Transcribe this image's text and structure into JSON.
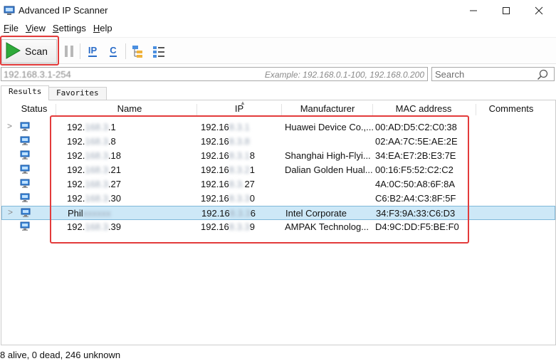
{
  "window": {
    "title": "Advanced IP Scanner"
  },
  "menu": [
    {
      "label_u": "F",
      "label_rest": "ile"
    },
    {
      "label_u": "V",
      "label_rest": "iew"
    },
    {
      "label_u": "S",
      "label_rest": "ettings"
    },
    {
      "label_u": "H",
      "label_rest": "elp"
    }
  ],
  "toolbar": {
    "scan_label": "Scan",
    "ip_label": "IP",
    "c_label": "C"
  },
  "range": {
    "value": "192.168.3.1-254",
    "example": "Example: 192.168.0.1-100, 192.168.0.200"
  },
  "search": {
    "placeholder": "Search"
  },
  "tabs": [
    "Results",
    "Favorites"
  ],
  "columns": {
    "status": "Status",
    "name": "Name",
    "ip": "IP",
    "manufacturer": "Manufacturer",
    "mac": "MAC address",
    "comments": "Comments"
  },
  "rows": [
    {
      "expand": ">",
      "name_a": "192.",
      "name_b": "168.3",
      "name_c": ".1",
      "ip_a": "192.16",
      "ip_b": "8.3.1",
      "ip_c": "",
      "manufacturer": "Huawei Device Co.,...",
      "mac": "00:AD:D5:C2:C0:38",
      "selected": false
    },
    {
      "expand": "",
      "name_a": "192.",
      "name_b": "168.3",
      "name_c": ".8",
      "ip_a": "192.16",
      "ip_b": "8.3.8",
      "ip_c": "",
      "manufacturer": "",
      "mac": "02:AA:7C:5E:AE:2E",
      "selected": false
    },
    {
      "expand": "",
      "name_a": "192.",
      "name_b": "168.3",
      "name_c": ".18",
      "ip_a": "192.16",
      "ip_b": "8.3.1",
      "ip_c": "8",
      "manufacturer": "Shanghai High-Flyi...",
      "mac": "34:EA:E7:2B:E3:7E",
      "selected": false
    },
    {
      "expand": "",
      "name_a": "192.",
      "name_b": "168.3",
      "name_c": ".21",
      "ip_a": "192.16",
      "ip_b": "8.3.2",
      "ip_c": "1",
      "manufacturer": "Dalian Golden Hual...",
      "mac": "00:16:F5:52:C2:C2",
      "selected": false
    },
    {
      "expand": "",
      "name_a": "192.",
      "name_b": "168.3",
      "name_c": ".27",
      "ip_a": "192.16",
      "ip_b": "8.3.",
      "ip_c": "27",
      "manufacturer": "",
      "mac": "4A:0C:50:A8:6F:8A",
      "selected": false
    },
    {
      "expand": "",
      "name_a": "192.",
      "name_b": "168.3",
      "name_c": ".30",
      "ip_a": "192.16",
      "ip_b": "8.3.3",
      "ip_c": "0",
      "manufacturer": "",
      "mac": "C6:B2:A4:C3:8F:5F",
      "selected": false
    },
    {
      "expand": ">",
      "name_a": "Phil",
      "name_b": "xxxxxx",
      "name_c": "",
      "ip_a": "192.16",
      "ip_b": "8.3.3",
      "ip_c": "6",
      "manufacturer": "Intel Corporate",
      "mac": "34:F3:9A:33:C6:D3",
      "selected": true
    },
    {
      "expand": "",
      "name_a": "192.",
      "name_b": "168.3",
      "name_c": ".39",
      "ip_a": "192.16",
      "ip_b": "8.3.3",
      "ip_c": "9",
      "manufacturer": "AMPAK Technolog...",
      "mac": "D4:9C:DD:F5:BE:F0",
      "selected": false
    }
  ],
  "status": {
    "text": "8 alive, 0 dead, 246 unknown"
  },
  "colors": {
    "highlight_red": "#e33b3b",
    "selection": "#cde8f7",
    "scan_green": "#2eaa3a"
  }
}
